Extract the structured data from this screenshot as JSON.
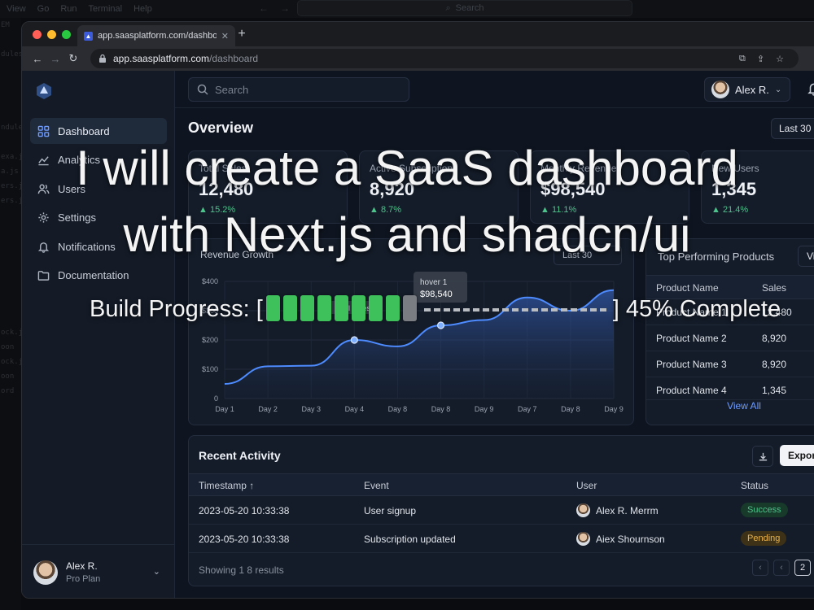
{
  "os": {
    "menu": [
      "View",
      "Go",
      "Run",
      "Terminal",
      "Help"
    ],
    "search_label": "Search",
    "left_strip": [
      "EM",
      "",
      "dules",
      "",
      "",
      "",
      "",
      "ndule",
      "",
      "exa.js",
      "a.js",
      "ers.js",
      "ers.js",
      "",
      "",
      "",
      "",
      "",
      "",
      "",
      "",
      "ock.js",
      "oon",
      "ock.js",
      "oon",
      "ord"
    ]
  },
  "browser": {
    "tab_title": "app.saasplatform.com/dashbo",
    "url_host": "app.saasplatform.com",
    "url_path": "/dashboard"
  },
  "sidebar": {
    "items": [
      {
        "label": "Dashboard",
        "icon": "grid-icon",
        "active": true
      },
      {
        "label": "Analytics",
        "icon": "chart-line-icon",
        "active": false
      },
      {
        "label": "Users",
        "icon": "users-icon",
        "active": false
      },
      {
        "label": "Settings",
        "icon": "gear-icon",
        "active": false
      },
      {
        "label": "Notifications",
        "icon": "bell-icon",
        "active": false
      },
      {
        "label": "Documentation",
        "icon": "folder-icon",
        "active": false
      }
    ],
    "user": {
      "name": "Alex R.",
      "plan": "Pro Plan"
    }
  },
  "header": {
    "search_placeholder": "Search",
    "user_name": "Alex R."
  },
  "overview": {
    "title": "Overview",
    "range_label": "Last 30 D"
  },
  "stats": [
    {
      "label": "Total Sales",
      "value": "12,480",
      "change": "15.2%"
    },
    {
      "label": "Active Subscriptions",
      "value": "8,920",
      "change": "8.7%"
    },
    {
      "label": "Monthly Revenue",
      "value": "$98,540",
      "change": "11.1%"
    },
    {
      "label": "New Users",
      "value": "1,345",
      "change": "21.4%"
    }
  ],
  "revenue_chart": {
    "title": "Revenue Growth",
    "range_label": "Last 30",
    "tooltip_title": "hover 1",
    "tooltip_value": "$98,540",
    "point_label": "Total Sales"
  },
  "chart_data": {
    "type": "area",
    "title": "Revenue Growth",
    "categories": [
      "Day 1",
      "Day 2",
      "Day 3",
      "Day 4",
      "Day 8",
      "Day 8",
      "Day 9",
      "Day 7",
      "Day 8",
      "Day 9"
    ],
    "values": [
      50,
      110,
      112,
      200,
      178,
      250,
      268,
      345,
      300,
      370
    ],
    "y_ticks": [
      "$400",
      "$300",
      "$200",
      "$100",
      "0"
    ],
    "ylim": [
      0,
      400
    ],
    "highlight_indices": [
      3,
      5
    ],
    "grid": true
  },
  "products": {
    "title": "Top Performing Products",
    "view_label": "View",
    "columns": [
      "Product Name",
      "Sales"
    ],
    "rows": [
      {
        "name": "Product Name 1",
        "sales": "12,480"
      },
      {
        "name": "Product Name 2",
        "sales": "8,920"
      },
      {
        "name": "Product Name 3",
        "sales": "8,920"
      },
      {
        "name": "Product Name 4",
        "sales": "1,345"
      }
    ],
    "view_all": "View All"
  },
  "activity": {
    "title": "Recent Activity",
    "export_label": "Export",
    "columns": [
      "Timestamp",
      "Event",
      "User",
      "Status"
    ],
    "sort_indicator": "↑",
    "rows": [
      {
        "timestamp": "2023-05-20 10:33:38",
        "event": "User signup",
        "user": "Alex R. Merrm",
        "status": "Success",
        "status_color": "#4cc38a"
      },
      {
        "timestamp": "2023-05-20 10:33:38",
        "event": "Subscription updated",
        "user": "Aiex Shournson",
        "status": "Pending",
        "status_color": "#e9b44c"
      }
    ],
    "footer": "Showing 1 8 results",
    "pages": [
      "‹",
      "‹",
      "2"
    ]
  },
  "overlay": {
    "line1": "I will create a SaaS dashboard",
    "line2": "with Next.js and shadcn/ui",
    "progress_prefix": "Build Progress: [",
    "progress_suffix": "] 45% Complete",
    "progress_fraction": 0.45
  }
}
